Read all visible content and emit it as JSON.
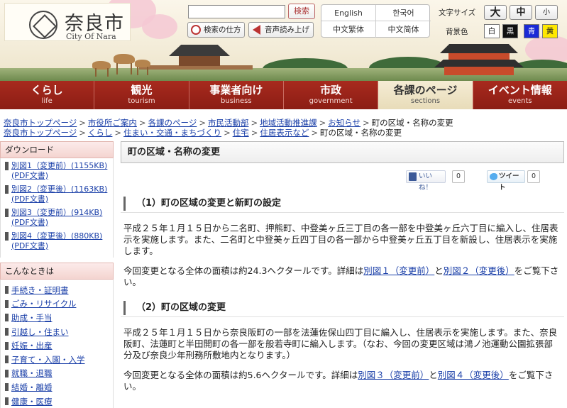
{
  "header": {
    "logo_jp": "奈良市",
    "logo_en": "City Of Nara",
    "search_button": "検索",
    "howto_button": "検索の仕方",
    "voice_button": "音声読み上げ",
    "languages": [
      "English",
      "한국어",
      "中文繁体",
      "中文简体"
    ],
    "font_size_label": "文字サイズ",
    "font_sizes": [
      "大",
      "中",
      "小"
    ],
    "bg_label": "背景色",
    "bg_colors": [
      "白",
      "黒",
      "青",
      "黄"
    ]
  },
  "nav": [
    {
      "jp": "くらし",
      "en": "life"
    },
    {
      "jp": "観光",
      "en": "tourism"
    },
    {
      "jp": "事業者向け",
      "en": "business"
    },
    {
      "jp": "市政",
      "en": "government"
    },
    {
      "jp": "各課のページ",
      "en": "sections"
    },
    {
      "jp": "イベント情報",
      "en": "events"
    }
  ],
  "breadcrumbs": {
    "line1": [
      "奈良市トップページ",
      "市役所ご案内",
      "各課のページ",
      "市民活動部",
      "地域活動推進課",
      "お知らせ"
    ],
    "line2": [
      "奈良市トップページ",
      "くらし",
      "住まい・交通・まちづくり",
      "住宅",
      "住居表示など"
    ],
    "current": "町の区域・名称の変更"
  },
  "sidebar": {
    "download_title": "ダウンロード",
    "downloads": [
      "別図1（変更前）(1155KB)(PDF文書)",
      "別図2（変更後）(1163KB)(PDF文書)",
      "別図3（変更前）(914KB)(PDF文書)",
      "別図4（変更後）(880KB)(PDF文書)"
    ],
    "konna_title": "こんなときは",
    "konna_items": [
      "手続き・証明書",
      "ごみ・リサイクル",
      "助成・手当",
      "引越し・住まい",
      "妊娠・出産",
      "子育て・入園・入学",
      "就職・退職",
      "結婚・離婚",
      "健康・医療"
    ]
  },
  "main": {
    "title": "町の区域・名称の変更",
    "like_label": "いいね！",
    "like_count": "0",
    "tweet_label": "ツイート",
    "tweet_count": "0",
    "section1_title": "（1）町の区域の変更と新町の設定",
    "section1_body": "平成２５年１月１５日から二名町、押熊町、中登美ヶ丘三丁目の各一部を中登美ヶ丘六丁目に編入し、住居表示を実施します。また、二名町と中登美ヶ丘四丁目の各一部から中登美ヶ丘五丁目を新設し、住居表示を実施します。",
    "section1_area_pre": "今回変更となる全体の面積は約24.3ヘクタールです。詳細は",
    "section1_link1": "別図１（変更前）",
    "section1_and": "と",
    "section1_link2": "別図２（変更後）",
    "section1_area_post": "をご覧下さい。",
    "section2_title": "（2）町の区域の変更",
    "section2_body": "平成２５年１月１５日から奈良阪町の一部を法蓮佐保山四丁目に編入し、住居表示を実施します。また、奈良阪町、法蓮町と半田開町の各一部を般若寺町に編入します。（なお、今回の変更区域は鴻ノ池運動公園拡張部分及び奈良少年刑務所敷地内となります。）",
    "section2_area_pre": "今回変更となる全体の面積は約5.6ヘクタールです。詳細は",
    "section2_link1": "別図３（変更前）",
    "section2_and": "と",
    "section2_link2": "別図４（変更後）",
    "section2_area_post": "をご覧下さい。"
  },
  "colors": {
    "nav_red": "#9b2318",
    "link_blue": "#1a3fa8",
    "sidebar_pink": "#f4d4d0"
  }
}
